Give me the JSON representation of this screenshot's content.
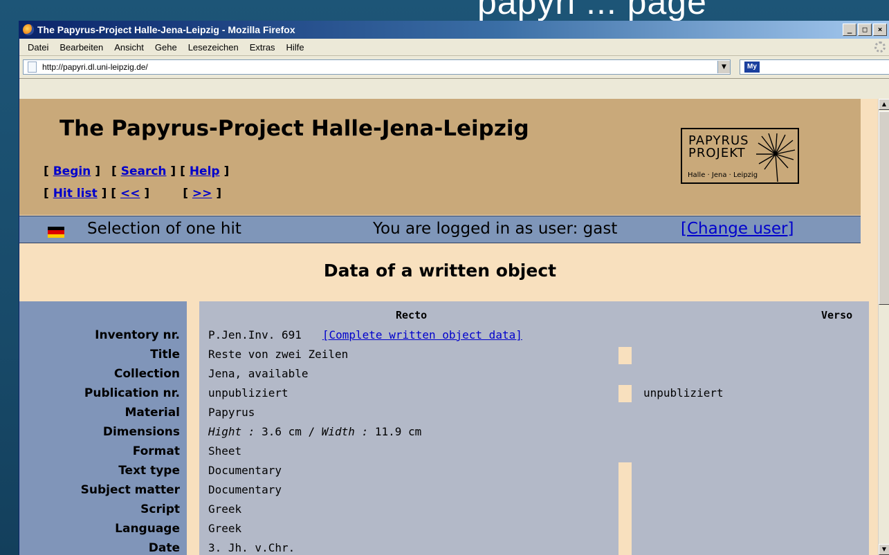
{
  "slide": {
    "title": "papyri ... page"
  },
  "browser": {
    "window_title": "The Papyrus-Project Halle-Jena-Leipzig - Mozilla Firefox",
    "controls": [
      "_",
      "□",
      "×"
    ],
    "menu": [
      "Datei",
      "Bearbeiten",
      "Ansicht",
      "Gehe",
      "Lesezeichen",
      "Extras",
      "Hilfe"
    ],
    "url": "http://papyri.dl.uni-leipzig.de/",
    "search_logo": "My"
  },
  "site": {
    "title": "The Papyrus-Project Halle-Jena-Leipzig",
    "nav": {
      "begin": "Begin",
      "search": "Search",
      "help": "Help",
      "hitlist": "Hit list",
      "prev": "<<",
      "next": ">>"
    },
    "logo": {
      "line1": "PAPYRUS",
      "line2": "PROJEKT",
      "line3": "Halle · Jena · Leipzig"
    }
  },
  "status": {
    "selection": "Selection of one hit",
    "logged_in": "You are logged in as user: gast",
    "change_user": "[Change user]",
    "flag_colors": [
      "#000000",
      "#dd0000",
      "#ffcc00"
    ]
  },
  "section_title": "Data of a written object",
  "table": {
    "header_recto": "Recto",
    "header_verso": "Verso",
    "link_complete": "[Complete written object data]",
    "dim_hight_label": "Hight :",
    "dim_hight_value": " 3.6 cm / ",
    "dim_width_label": "Width :",
    "dim_width_value": " 11.9 cm",
    "rows": [
      {
        "label": "Inventory nr.",
        "recto": "P.Jen.Inv. 691",
        "verso": ""
      },
      {
        "label": "Title",
        "recto": "Reste von zwei Zeilen",
        "verso": ""
      },
      {
        "label": "Collection",
        "recto": "Jena, available",
        "verso": ""
      },
      {
        "label": "Publication nr.",
        "recto": "unpubliziert",
        "verso": "unpubliziert"
      },
      {
        "label": "Material",
        "recto": "Papyrus",
        "verso": ""
      },
      {
        "label": "Dimensions",
        "recto": "",
        "verso": ""
      },
      {
        "label": "Format",
        "recto": "Sheet",
        "verso": ""
      },
      {
        "label": "Text type",
        "recto": "Documentary",
        "verso": ""
      },
      {
        "label": "Subject matter",
        "recto": "Documentary",
        "verso": ""
      },
      {
        "label": "Script",
        "recto": "Greek",
        "verso": ""
      },
      {
        "label": "Language",
        "recto": "Greek",
        "verso": ""
      },
      {
        "label": "Date",
        "recto": "3. Jh. v.Chr.",
        "verso": ""
      }
    ]
  }
}
